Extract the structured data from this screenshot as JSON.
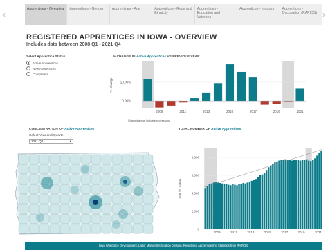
{
  "tabs": [
    {
      "label": "Apprentices - Overview",
      "active": true
    },
    {
      "label": "Apprentices - Gender",
      "active": false
    },
    {
      "label": "Apprentices - Age",
      "active": false
    },
    {
      "label": "Apprentices - Race and Ethnicity",
      "active": false
    },
    {
      "label": "Apprentices - Education and Veterans",
      "active": false
    },
    {
      "label": "Apprentices - Industry",
      "active": false
    },
    {
      "label": "Apprentices - Occupation (RAPIDS)",
      "active": false
    }
  ],
  "header": {
    "title": "REGISTERED APPRENTICES IN IOWA - OVERVIEW",
    "subtitle": "Includes data between 2008 Q1 - 2021 Q4"
  },
  "status_panel": {
    "label": "Select Apprentice Status",
    "options": [
      "Active Apprentices",
      "New Apprentices",
      "Completers"
    ],
    "selected": "Active Apprentices"
  },
  "pct_chart_title": {
    "prefix": "% CHANGE IN ",
    "accent": "Active Apprentices",
    "suffix": " VS PREVIOUS YEAR"
  },
  "map_title": {
    "prefix": "CONCENTRATION OF ",
    "accent": "Active Apprentices"
  },
  "total_title": {
    "prefix": "TOTAL NUMBER OF ",
    "accent": "Active Apprentices"
  },
  "year_select": {
    "label": "Select Year and Quarter",
    "value": "2021 Q4"
  },
  "recession_note": "Shaded areas indicate recessions",
  "footer": "Iowa Workforce Development, Labor Market Information Division. Registered Apprenticeship Statistics from RAPIDS.",
  "colors": {
    "teal": "#0c7b8a",
    "red": "#b03a2e",
    "shade": "#d9d9d9"
  },
  "chart_data": [
    {
      "type": "bar",
      "title": "% CHANGE IN Active Apprentices VS PREVIOUS YEAR",
      "ylabel": "% Change",
      "x": [
        2008,
        2009,
        2010,
        2011,
        2012,
        2013,
        2014,
        2015,
        2016,
        2017,
        2018,
        2019,
        2020,
        2021
      ],
      "values": [
        11.5,
        -3.5,
        -2.5,
        -0.8,
        1.5,
        4.5,
        9.5,
        19.5,
        15.5,
        12.5,
        -2.0,
        -1.5,
        -0.2,
        6.5
      ],
      "xticks": [
        2009,
        2011,
        2013,
        2015,
        2017,
        2019,
        2021
      ],
      "xtick_labels": [
        "2009",
        "2011",
        "2013",
        "2015",
        "2017",
        "2019",
        "2021"
      ],
      "yticks": [
        0,
        10
      ],
      "ytick_labels": [
        "0.00%",
        "10.00%"
      ],
      "ylim": [
        -4,
        21
      ],
      "recessions": [
        [
          2008,
          2009
        ],
        [
          2020,
          2021
        ]
      ],
      "colors": {
        "positive": "#0c7b8a",
        "negative": "#b03a2e"
      }
    },
    {
      "type": "bar",
      "title": "TOTAL NUMBER OF Active Apprentices",
      "ylabel": "Total by Status",
      "x": [
        2008.0,
        2008.25,
        2008.5,
        2008.75,
        2009.0,
        2009.25,
        2009.5,
        2009.75,
        2010.0,
        2010.25,
        2010.5,
        2010.75,
        2011.0,
        2011.25,
        2011.5,
        2011.75,
        2012.0,
        2012.25,
        2012.5,
        2012.75,
        2013.0,
        2013.25,
        2013.5,
        2013.75,
        2014.0,
        2014.25,
        2014.5,
        2014.75,
        2015.0,
        2015.25,
        2015.5,
        2015.75,
        2016.0,
        2016.25,
        2016.5,
        2016.75,
        2017.0,
        2017.25,
        2017.5,
        2017.75,
        2018.0,
        2018.25,
        2018.5,
        2018.75,
        2019.0,
        2019.25,
        2019.5,
        2019.75,
        2020.0,
        2020.25,
        2020.5,
        2020.75,
        2021.0,
        2021.25,
        2021.5,
        2021.75
      ],
      "values": [
        4600,
        4800,
        5000,
        5100,
        5200,
        5300,
        5200,
        5150,
        5100,
        5050,
        5000,
        4950,
        4900,
        5000,
        4950,
        4900,
        5000,
        5050,
        5150,
        5100,
        5200,
        5300,
        5400,
        5500,
        5600,
        5800,
        6000,
        6100,
        6300,
        6600,
        6900,
        7100,
        7300,
        7450,
        7550,
        7650,
        7700,
        7750,
        7800,
        7750,
        7700,
        7650,
        7700,
        7750,
        7700,
        7650,
        7700,
        7750,
        7800,
        7650,
        7600,
        7700,
        7900,
        8200,
        8500,
        8700
      ],
      "xticks": [
        2009,
        2011,
        2013,
        2015,
        2017,
        2019,
        2021
      ],
      "xtick_labels": [
        "2009",
        "2011",
        "2013",
        "2015",
        "2017",
        "2019",
        "2021"
      ],
      "yticks": [
        0,
        2000,
        4000,
        6000,
        8000
      ],
      "ytick_labels": [
        "0",
        "2,000",
        "4,000",
        "6,000",
        "8,000"
      ],
      "ylim": [
        0,
        9000
      ],
      "trendline": [
        [
          2008,
          4700
        ],
        [
          2022,
          8900
        ]
      ],
      "recessions": [
        [
          2008,
          2009.5
        ],
        [
          2020,
          2020.75
        ]
      ],
      "color": "#0c7b8a"
    }
  ]
}
